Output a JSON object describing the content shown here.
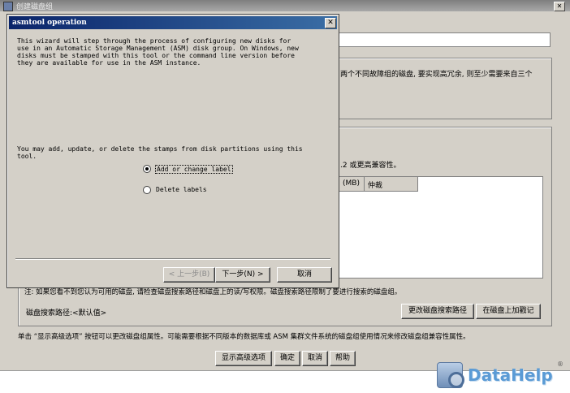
{
  "background_window": {
    "title": "创建磁盘组",
    "desc_fragment": "两个不同故障组的磁盘, 要实现高冗余, 则至少需要来自三个",
    "compat_fragment": ".2 或更高兼容性。",
    "table_headers": [
      "(MB)",
      "仲裁"
    ],
    "note_text": "注: 如果您看不到您认为可用的磁盘, 请检查磁盘搜索路径和磁盘上的读/写权限。磁盘搜索路径限制了要进行搜索的磁盘组。",
    "search_path_text": "磁盘搜索路径:<默认值>",
    "change_search_button": "更改磁盘搜索路径",
    "stamp_disks_button": "在磁盘上加戳记",
    "advanced_info": "单击 “显示高级选项” 按钮可以更改磁盘组属性。可能需要根据不同版本的数据库或 ASM 集群文件系统的磁盘组使用情况来修改磁盘组兼容性属性。",
    "show_advanced_button": "显示高级选项",
    "ok_button": "确定",
    "cancel_button": "取消",
    "help_button": "帮助",
    "close_glyph": "✕"
  },
  "dialog": {
    "title": "asmtool operation",
    "close_glyph": "✕",
    "intro_text": "This wizard will step through the process of configuring new disks for\nuse in an Automatic Storage Management (ASM) disk group. On Windows, new\ndisks must be stamped with this tool or the command line version before\nthey are available for use in the ASM instance.",
    "instructions": "You may add, update, or delete the stamps from disk partitions using this\ntool.",
    "options": [
      {
        "label": "Add or change label",
        "selected": true
      },
      {
        "label": "Delete labels",
        "selected": false
      }
    ],
    "back_button": "< 上一步(B)",
    "next_button": "下一步(N) >",
    "cancel_button": "取消"
  },
  "watermark": {
    "text": "DataHelp",
    "registered": "®"
  }
}
